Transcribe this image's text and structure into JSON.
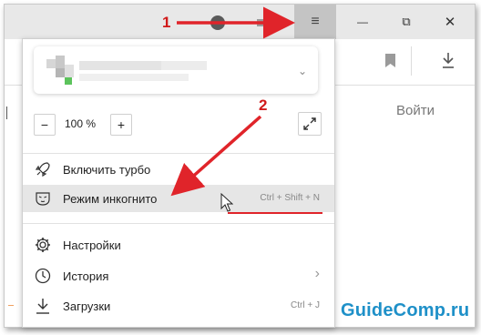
{
  "titlebar": {
    "menu_button_glyph": "≡",
    "minimize_glyph": "—",
    "restore_glyph": "⧉",
    "close_glyph": "✕"
  },
  "page": {
    "login_label": "Войти"
  },
  "menu": {
    "account": {
      "chevron_glyph": "⌄"
    },
    "zoom": {
      "minus_label": "−",
      "value": "100 %",
      "plus_label": "+"
    },
    "items": [
      {
        "label": "Включить турбо",
        "shortcut": "",
        "icon": "rocket-icon"
      },
      {
        "label": "Режим инкогнито",
        "shortcut": "Ctrl + Shift + N",
        "icon": "incognito-mask-icon"
      },
      {
        "label": "Настройки",
        "shortcut": "",
        "icon": "gear-icon"
      },
      {
        "label": "История",
        "shortcut": "›",
        "icon": "clock-icon"
      },
      {
        "label": "Загрузки",
        "shortcut": "Ctrl + J",
        "icon": "download-icon"
      }
    ]
  },
  "annotations": {
    "step1": "1",
    "step2": "2",
    "color": "#e0242a"
  },
  "watermark": "GuideComp.ru"
}
